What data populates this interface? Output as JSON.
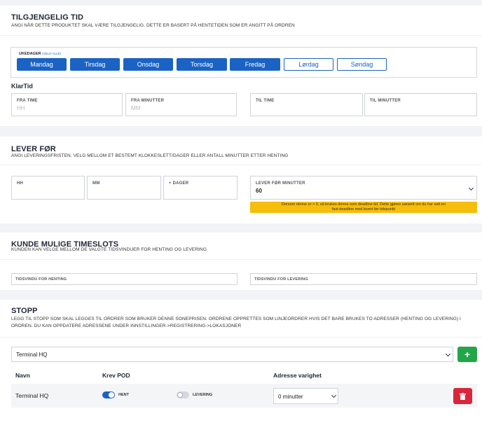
{
  "availability": {
    "title": "TILGJENGELIG TID",
    "subtitle": "ANGI NÅR DETTE PRODUKTET SKAL VÆRE TILGJENGELIG. DETTE ER BASERT PÅ HENTETIDEN SOM ER ANGITT PÅ ORDREN",
    "weekdays_label": "UKEDAGER",
    "select_all": "(VELG ALLE)",
    "days": [
      {
        "label": "Mandag",
        "selected": true
      },
      {
        "label": "Tirsdag",
        "selected": true
      },
      {
        "label": "Onsdag",
        "selected": true
      },
      {
        "label": "Torsdag",
        "selected": true
      },
      {
        "label": "Fredag",
        "selected": true
      },
      {
        "label": "Lørdag",
        "selected": false
      },
      {
        "label": "Søndag",
        "selected": false
      }
    ],
    "klartid_label": "KlarTid",
    "fields": {
      "from_hour": {
        "label": "FRA TIME",
        "placeholder": "HH"
      },
      "from_minutes": {
        "label": "FRA MINUTTER",
        "placeholder": "MM"
      },
      "to_hour": {
        "label": "TIL TIME",
        "placeholder": ""
      },
      "to_minutes": {
        "label": "TIL MINUTTER",
        "placeholder": ""
      }
    }
  },
  "deliver_before": {
    "title": "LEVER FØR",
    "subtitle": "ANGI LEVERINGSFRISTEN. VELG MELLOM ET BESTEMT KLOKKESLETT/DAGER ELLER ANTALL MINUTTER ETTER HENTING",
    "hh_label": "HH",
    "mm_label": "MM",
    "days_label": "+ DAGER",
    "minutes_label": "LEVER FØR MINUTTER",
    "minutes_value": "60",
    "warning": "Dersom denne er > 0, så brukes denne som deadline tid. Dette gjøres uansett om du har satt en fast deadline med levert før tidspunkt",
    "warning_color": "#f5bd0c"
  },
  "timeslots": {
    "title": "KUNDE MULIGE TIMESLOTS",
    "subtitle": "KUNDEN KAN VELGE MELLOM DE VALGTE TIDSVINDUER FOR HENTING OG LEVERING",
    "pickup_label": "TIDSVINDU FOR HENTING",
    "delivery_label": "TIDSVINDU FOR LEVERING"
  },
  "stops": {
    "title": "STOPP",
    "subtitle": "LEGG TIL STOPP SOM SKAL LEGGES TIL ORDRER SOM BRUKER DENNE SONEPRISEN. ORDRENE OPPRETTES SOM LINJEORDRER HVIS DET BARE BRUKES TO ADRESSER (HENTING OG LEVERING) I ORDREN. DU KAN OPPDATERE ADRESSENE UNDER INNSTILLINGER->REGISTRERING->LOKASJONER",
    "selected_location": "Terminal HQ",
    "add_symbol": "+",
    "columns": {
      "name": "Navn",
      "pod": "Krev POD",
      "duration": "Adresse varighet"
    },
    "rows": [
      {
        "name": "Terminal HQ",
        "pickup_label": "HENT",
        "pickup_on": true,
        "delivery_label": "LEVERING",
        "delivery_on": false,
        "duration": "0 minutter"
      }
    ],
    "colors": {
      "primary": "#1a63c4",
      "add": "#22a648",
      "delete": "#d9263a"
    }
  }
}
